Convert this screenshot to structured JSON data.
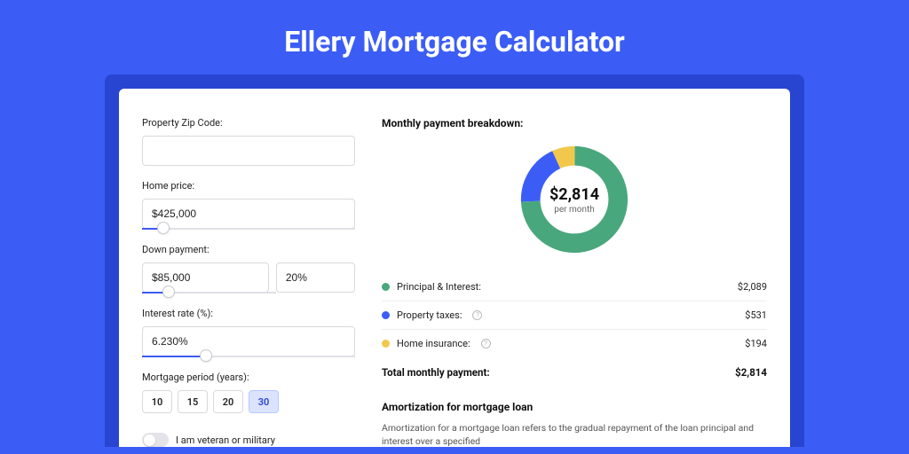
{
  "title": "Ellery Mortgage Calculator",
  "form": {
    "zip_label": "Property Zip Code:",
    "zip_value": "",
    "home_price_label": "Home price:",
    "home_price_value": "$425,000",
    "home_price_slider_pct": 10,
    "down_payment_label": "Down payment:",
    "down_payment_value": "$85,000",
    "down_payment_pct_value": "20%",
    "down_payment_slider_pct": 20,
    "interest_label": "Interest rate (%):",
    "interest_value": "6.230%",
    "interest_slider_pct": 30,
    "period_label": "Mortgage period (years):",
    "periods": [
      "10",
      "15",
      "20",
      "30"
    ],
    "period_selected": "30",
    "veteran_label": "I am veteran or military"
  },
  "breakdown": {
    "title": "Monthly payment breakdown:",
    "donut_amount": "$2,814",
    "donut_sub": "per month",
    "items": [
      {
        "label": "Principal & Interest:",
        "value": "$2,089",
        "color": "green",
        "info": false
      },
      {
        "label": "Property taxes:",
        "value": "$531",
        "color": "blue",
        "info": true
      },
      {
        "label": "Home insurance:",
        "value": "$194",
        "color": "yellow",
        "info": true
      }
    ],
    "total_label": "Total monthly payment:",
    "total_value": "$2,814"
  },
  "chart_data": {
    "type": "pie",
    "title": "Monthly payment breakdown",
    "series": [
      {
        "name": "Principal & Interest",
        "value": 2089,
        "color": "#49a77d"
      },
      {
        "name": "Property taxes",
        "value": 531,
        "color": "#3b5df5"
      },
      {
        "name": "Home insurance",
        "value": 194,
        "color": "#f2c84c"
      }
    ],
    "total": 2814,
    "unit": "USD per month"
  },
  "amort": {
    "title": "Amortization for mortgage loan",
    "desc": "Amortization for a mortgage loan refers to the gradual repayment of the loan principal and interest over a specified"
  }
}
